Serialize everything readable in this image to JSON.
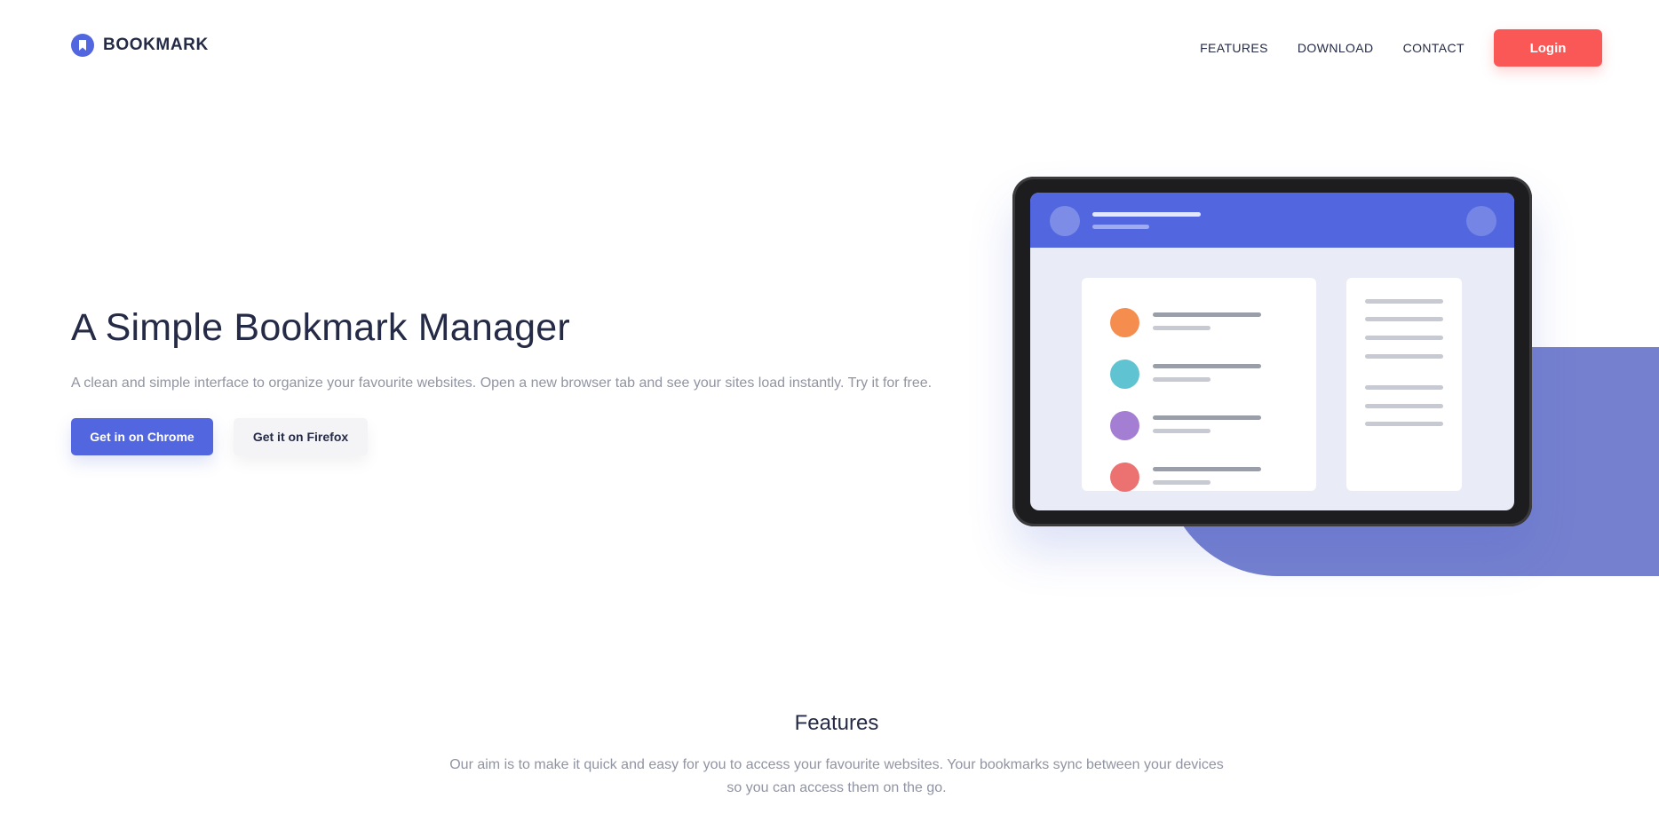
{
  "brand": {
    "name": "BOOKMARK",
    "accent": "#5267df",
    "red": "#fa5757",
    "blob": "#7580cf"
  },
  "nav": {
    "items": [
      "FEATURES",
      "DOWNLOAD",
      "CONTACT"
    ],
    "login": "Login"
  },
  "hero": {
    "title": "A Simple Bookmark Manager",
    "description": "A clean and simple interface to organize your favourite websites. Open a new browser tab and see your sites load instantly. Try it for free.",
    "chrome_button": "Get in on Chrome",
    "firefox_button": "Get it on Firefox"
  },
  "illustration": {
    "dot_colors": [
      "#f58d4f",
      "#5fc3d2",
      "#a47ed3",
      "#ec7171"
    ]
  },
  "features": {
    "title": "Features",
    "description": "Our aim is to make it quick and easy for you to access your favourite websites. Your bookmarks sync between your devices so you can access them on the go."
  },
  "icons": {
    "logo": "bookmark-logo-icon"
  }
}
